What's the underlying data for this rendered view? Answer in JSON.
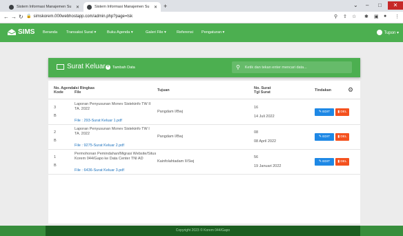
{
  "browser": {
    "tabs": [
      {
        "title": "Sistem Informasi Manajemen Su",
        "close": "✕"
      },
      {
        "title": "Sistem Informasi Manajemen Su",
        "close": "✕"
      }
    ],
    "new_tab": "+",
    "url": "simskorem.000webhostapp.com/admin.php?page=tsk",
    "window": {
      "minimize": "–",
      "maximize": "□",
      "close": "✕"
    }
  },
  "navbar": {
    "brand": "SIMS",
    "items": [
      "Beranda",
      "Transaksi Surat ▾",
      "Buku Agenda ▾",
      "Galeri File ▾",
      "Referensi",
      "Pengaturan ▾"
    ],
    "user": "Tupon ▾"
  },
  "header": {
    "title": "Surat Keluar",
    "add_label": "Tambah Data",
    "search_placeholder": "Ketik dan tekan enter mencari data..."
  },
  "table": {
    "columns": {
      "agenda": "No. Agenda",
      "kode": "Kode",
      "ringkasan": "Isi Ringkas",
      "file": "File",
      "tujuan": "Tujuan",
      "no_surat": "No. Surat",
      "tgl_surat": "Tgl Surat",
      "tindakan": "Tindakan"
    },
    "rows": [
      {
        "agenda": "3",
        "kode": "B",
        "ringkasan": "Laporan Penyusunan Monev Sistekinfo TW II TA. 2022",
        "file": "File : 293-Surat Keluar 1.pdf",
        "tujuan": "Pangdam I/Bwj",
        "no_surat": "16",
        "tgl_surat": "14 Juli 2022"
      },
      {
        "agenda": "2",
        "kode": "B",
        "ringkasan": "Laporan Penyusunan Monev Sistekinfo TW I TA. 2022",
        "file": "File : 9275-Surat Keluar 2.pdf",
        "tujuan": "Pangdam I/Bwj",
        "no_surat": "08",
        "tgl_surat": "08 April 2022"
      },
      {
        "agenda": "1",
        "kode": "B",
        "ringkasan": "Permohonan Pemindahan/Migrasi Website/Situs Korem 044/Gapo ke Data Center TNI AD",
        "file": "File : 6436-Surat Keluar 3.pdf",
        "tujuan": "Kainfolahtadam II/Swj",
        "no_surat": "56",
        "tgl_surat": "19 Januari 2022"
      }
    ],
    "edit_label": "EDIT",
    "delete_label": "DEL"
  },
  "footer": {
    "text": "Copyright 2023 © Korem 044/Gapo"
  },
  "colors": {
    "primary": "#4caf50",
    "edit": "#1e88e5",
    "delete": "#f4511e",
    "footer": "#1b5e20"
  }
}
